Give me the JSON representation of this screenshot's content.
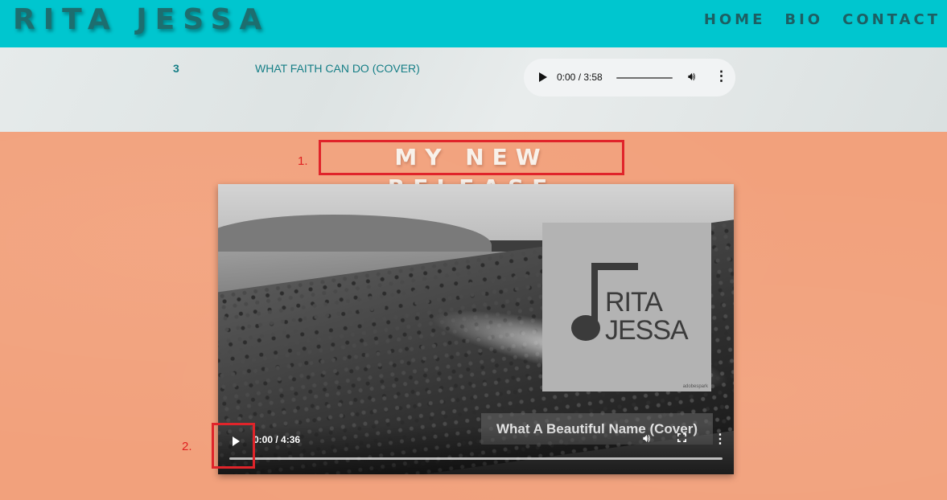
{
  "header": {
    "logo": "RITA JESSA",
    "nav": [
      "HOME",
      "BIO",
      "CONTACT"
    ]
  },
  "track": {
    "number": "3",
    "title": "WHAT FAITH CAN DO (COVER)",
    "audio_time": "0:00 / 3:58"
  },
  "release": {
    "annotation_1": "1.",
    "annotation_2": "2.",
    "title": "MY NEW RELEASE",
    "cover_line1": "RITA",
    "cover_line2": "JESSA",
    "cover_watermark": "adobespark",
    "caption": "What A Beautiful Name (Cover)",
    "video_time": "0:00 / 4:36"
  },
  "colors": {
    "header_bg": "#00c6cf",
    "section_bg": "#f2a17c",
    "annotation_red": "#e0242a",
    "track_teal": "#157e86"
  }
}
